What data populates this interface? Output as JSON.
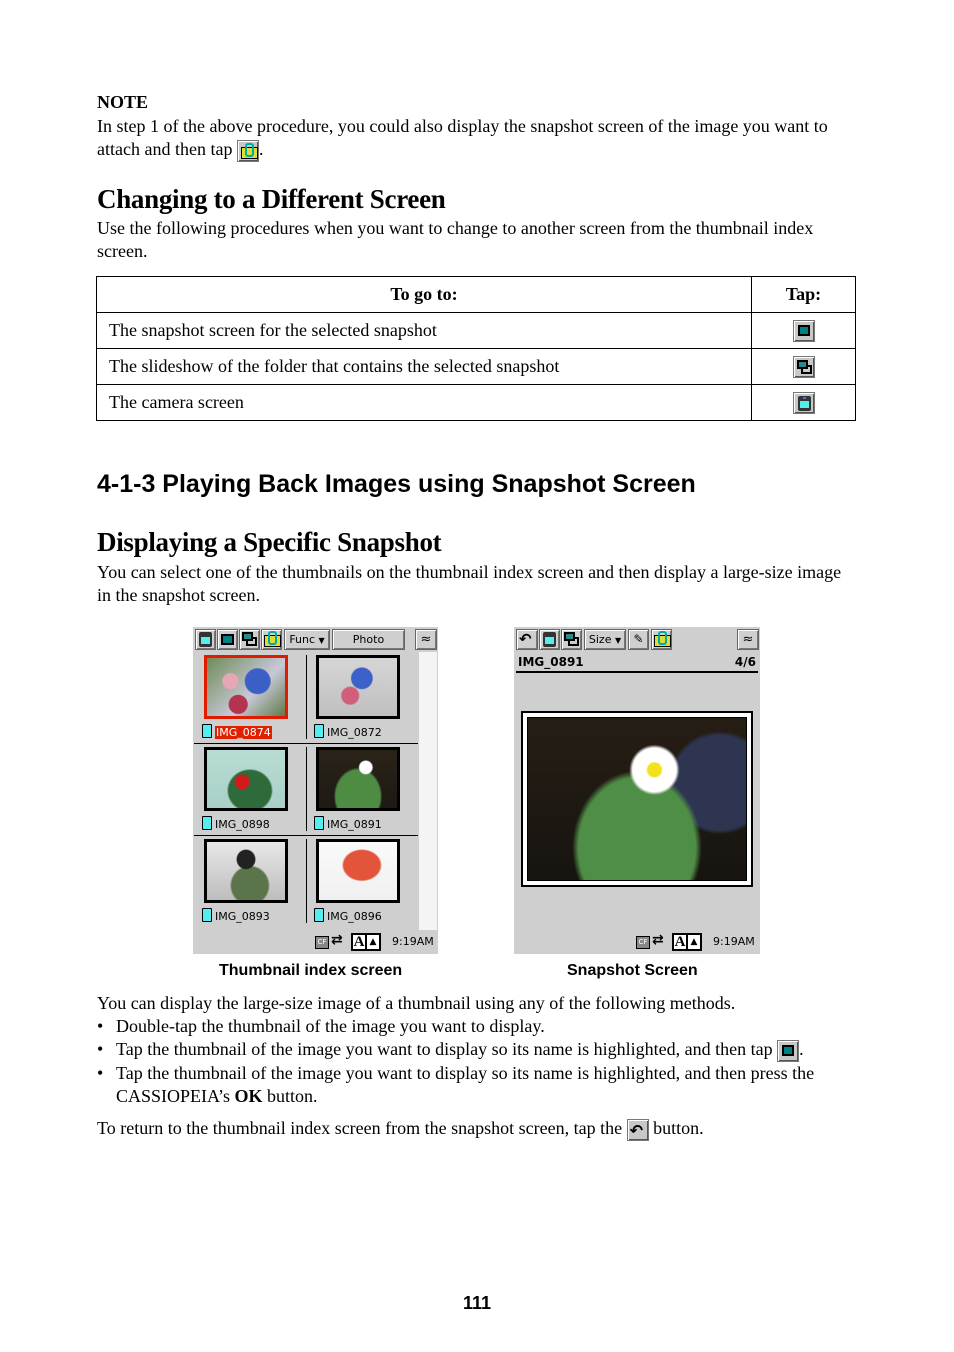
{
  "note": {
    "title": "NOTE",
    "text_before_icon": "In step 1 of the above procedure, you could also display the snapshot screen of the image you want to attach and then tap ",
    "text_after_icon": ".",
    "icon": "attach-mail-icon"
  },
  "changing": {
    "heading": "Changing to a Different Screen",
    "intro": "Use the following procedures when you want to change to another screen from the thumbnail index screen.",
    "table": {
      "headers": [
        "To go to:",
        "Tap:"
      ],
      "rows": [
        {
          "destination": "The snapshot screen for the selected snapshot",
          "icon": "snapshot-screen-icon"
        },
        {
          "destination": "The slideshow of the folder that contains the selected snapshot",
          "icon": "slideshow-icon"
        },
        {
          "destination": "The camera screen",
          "icon": "camera-screen-icon"
        }
      ]
    }
  },
  "section": {
    "heading": "4-1-3 Playing Back Images using Snapshot Screen"
  },
  "displaying": {
    "heading": "Displaying a Specific Snapshot",
    "intro": "You can select one of the thumbnails on the thumbnail index screen and then display a large-size image in the snapshot screen."
  },
  "thumbnail_screen": {
    "toolbar": {
      "func_label": "Func",
      "photo_label": "Photo"
    },
    "thumbnails": [
      {
        "name": "IMG_0874",
        "selected": true
      },
      {
        "name": "IMG_0872",
        "selected": false
      },
      {
        "name": "IMG_0898",
        "selected": false
      },
      {
        "name": "IMG_0891",
        "selected": false
      },
      {
        "name": "IMG_0893",
        "selected": false
      },
      {
        "name": "IMG_0896",
        "selected": false
      }
    ],
    "status": {
      "cf": "CF",
      "font_a": "A",
      "time": "9:19AM"
    },
    "caption": "Thumbnail index screen"
  },
  "snapshot_screen": {
    "toolbar": {
      "size_label": "Size"
    },
    "image_name": "IMG_0891",
    "position": "4/6",
    "status": {
      "cf": "CF",
      "font_a": "A",
      "time": "9:19AM"
    },
    "caption": "Snapshot Screen"
  },
  "methods": {
    "intro": "You can display the large-size image of a thumbnail using any of the following methods.",
    "items": [
      {
        "text": "Double-tap the thumbnail of the image you want to display."
      },
      {
        "text": "Tap the thumbnail of the image you want to display so its name is highlighted, and then tap ",
        "after": "."
      },
      {
        "text_before": "Tap the thumbnail of the image you want to display so its name is highlighted, and then press the CASSIOPEIA’s ",
        "bold": "OK",
        "text_after": " button."
      }
    ],
    "return_before": "To return to the thumbnail index screen from the snapshot screen, tap the ",
    "return_after": " button."
  },
  "page_number": "111"
}
